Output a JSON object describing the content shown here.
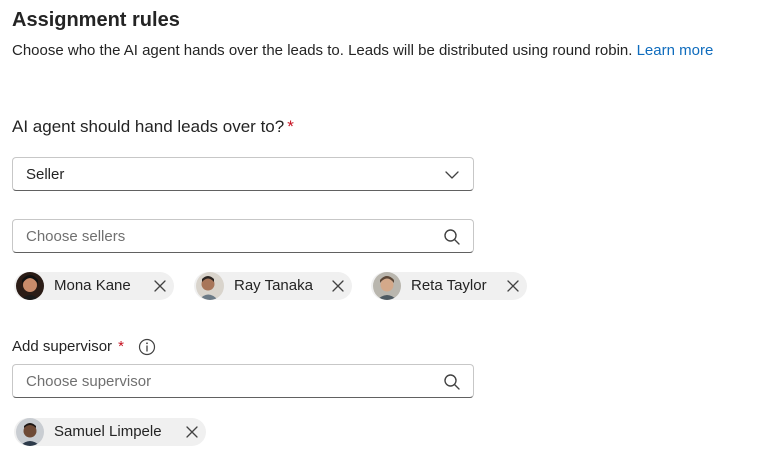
{
  "header": {
    "title": "Assignment rules",
    "description": "Choose who the AI agent hands over the leads to. Leads will be distributed using round robin.",
    "learn_more": "Learn more"
  },
  "handover": {
    "label": "AI agent should hand leads over to?",
    "required_mark": "*",
    "selected": "Seller",
    "icon": "chevron-down-icon"
  },
  "sellers": {
    "placeholder": "Choose sellers",
    "icon": "search-icon",
    "selected": [
      {
        "name": "Mona Kane"
      },
      {
        "name": "Ray Tanaka"
      },
      {
        "name": "Reta Taylor"
      }
    ]
  },
  "supervisor": {
    "label": "Add supervisor",
    "required_mark": "*",
    "info_icon": "info-icon",
    "placeholder": "Choose supervisor",
    "icon": "search-icon",
    "selected": [
      {
        "name": "Samuel Limpele"
      }
    ]
  },
  "colors": {
    "link": "#0f6cbd",
    "required": "#c50f1f",
    "chip_bg": "#f0f0f0",
    "border": "#c7c7c7"
  }
}
